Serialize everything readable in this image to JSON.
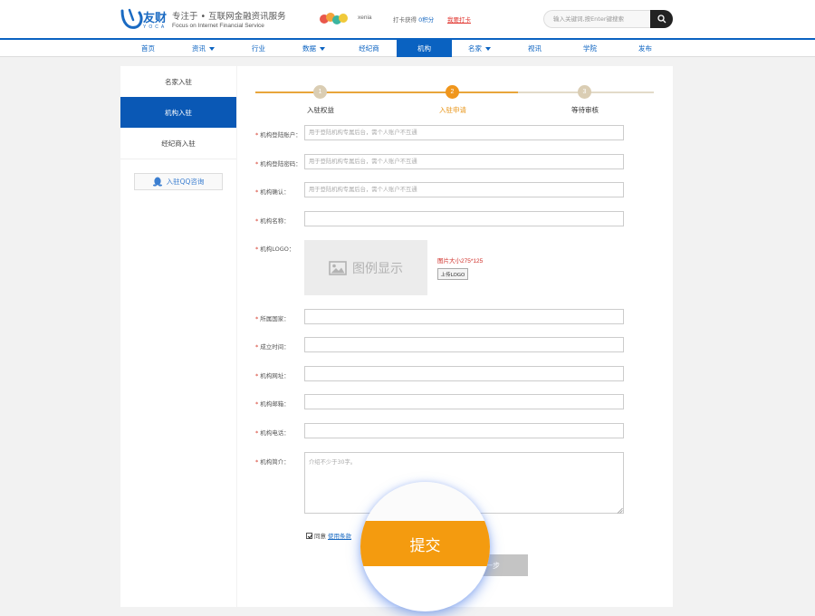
{
  "header": {
    "logo_text": "友财",
    "logo_sub": "YOCA",
    "slogan": "专注于 • 互联网金融资讯服务",
    "slogan_en": "Focus on Internet Financial Service",
    "username": "xenia",
    "checkin_label": "打卡获得",
    "points": "0积分",
    "checkin_link": "我要打卡",
    "search_placeholder": "输入关键词,按Enter键搜索"
  },
  "nav": {
    "items": [
      {
        "label": "首页",
        "dropdown": false
      },
      {
        "label": "资讯",
        "dropdown": true
      },
      {
        "label": "行业",
        "dropdown": false
      },
      {
        "label": "数据",
        "dropdown": true
      },
      {
        "label": "经纪商",
        "dropdown": false
      },
      {
        "label": "机构",
        "dropdown": false,
        "active": true
      },
      {
        "label": "名家",
        "dropdown": true
      },
      {
        "label": "视讯",
        "dropdown": false
      },
      {
        "label": "学院",
        "dropdown": false
      },
      {
        "label": "发布",
        "dropdown": false
      }
    ]
  },
  "sidebar": {
    "items": [
      "名家入驻",
      "机构入驻",
      "经纪商入驻"
    ],
    "active_index": 1,
    "qq_button": "入驻QQ咨询"
  },
  "steps": {
    "items": [
      {
        "num": "1",
        "label": "入驻权益"
      },
      {
        "num": "2",
        "label": "入驻申请"
      },
      {
        "num": "3",
        "label": "等待审核"
      }
    ],
    "current": 2
  },
  "form": {
    "account": {
      "label": "机构登陆账户：",
      "placeholder": "用于登陆机构专属后台，需个人账户不互通"
    },
    "password": {
      "label": "机构登陆密码：",
      "placeholder": "用于登陆机构专属后台，需个人账户不互通"
    },
    "confirm": {
      "label": "机构确认：",
      "placeholder": "用于登陆机构专属后台，需个人账户不互通"
    },
    "name": {
      "label": "机构名称："
    },
    "logo": {
      "label": "机构LOGO：",
      "placeholder_text": "图例显示",
      "size_hint": "图片大小275*125",
      "upload_label": "上传LOGO"
    },
    "country": {
      "label": "所属国家："
    },
    "founded": {
      "label": "成立时间："
    },
    "website": {
      "label": "机构网址："
    },
    "email": {
      "label": "机构邮箱："
    },
    "phone": {
      "label": "机构电话："
    },
    "intro": {
      "label": "机构简介：",
      "placeholder": "介绍不少于30字。"
    },
    "required_mark": "*",
    "agree_label": "同意",
    "terms_link": "使用条款",
    "prev_button": "一步",
    "submit_button": "提交"
  },
  "colors": {
    "brand_blue": "#0a62c1",
    "step_orange": "#e8a53b",
    "submit_orange": "#f49b0f",
    "required_red": "#d43a2a"
  }
}
